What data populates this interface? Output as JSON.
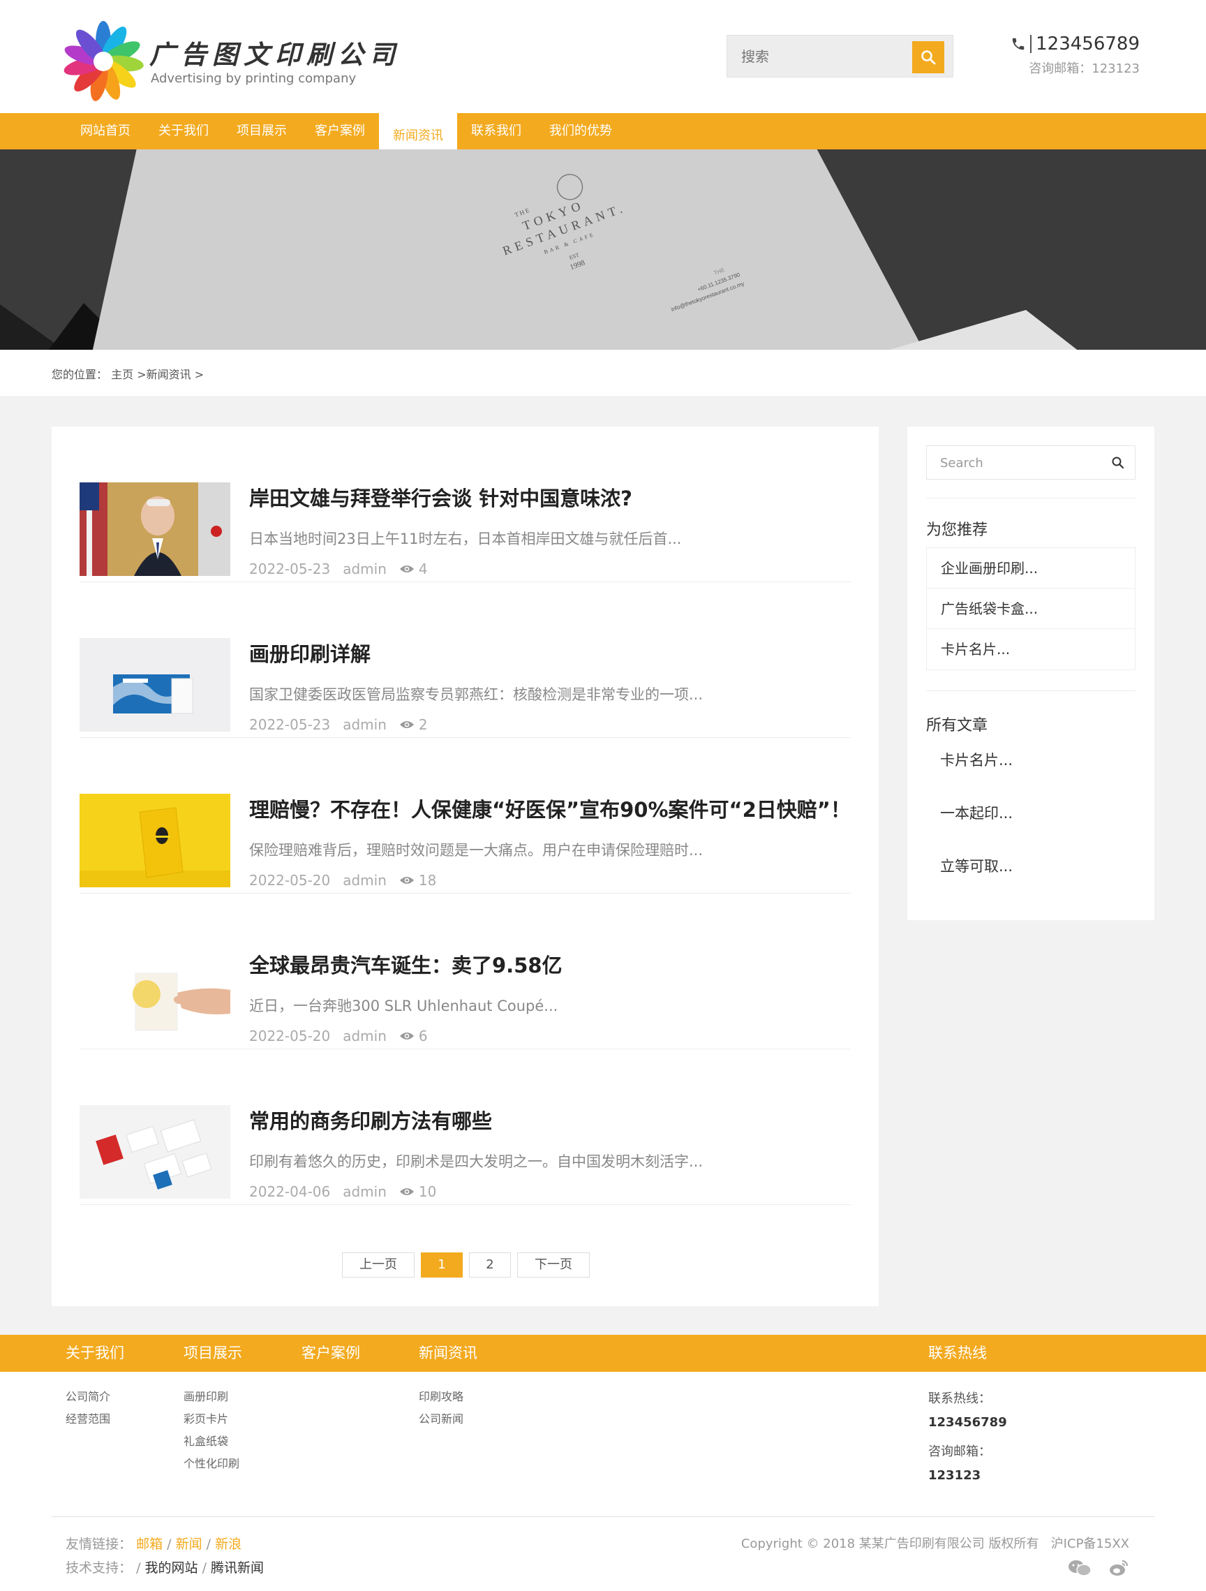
{
  "header": {
    "logo_cn": "广告图文印刷公司",
    "logo_en": "Advertising by printing company",
    "search_placeholder": "搜索",
    "phone": "123456789",
    "email": "咨询邮箱：123123"
  },
  "nav": {
    "items": [
      "网站首页",
      "关于我们",
      "项目展示",
      "客户案例",
      "新闻资讯",
      "联系我们",
      "我们的优势"
    ],
    "active": "新闻资讯"
  },
  "banner": {
    "line1": "THE",
    "line2": "TOKYO",
    "line3": "RESTAURANT.",
    "line4": "BAR & CAFE",
    "line5": "EST",
    "line6": "1998",
    "phone": "+60.11.1235.3790",
    "email": "info@thetokyorestaurant.co.my",
    "tag": "THE"
  },
  "breadcrumb": {
    "label": "您的位置：",
    "home": "主页",
    "current": "新闻资讯",
    "sep": ">"
  },
  "articles": [
    {
      "title": "岸田文雄与拜登举行会谈 针对中国意味浓?",
      "desc": "日本当地时间23日上午11时左右，日本首相岸田文雄与就任后首...",
      "date": "2022-05-23",
      "author": "admin",
      "views": "4"
    },
    {
      "title": "画册印刷详解",
      "desc": "国家卫健委医政医管局监察专员郭燕红：核酸检测是非常专业的一项...",
      "date": "2022-05-23",
      "author": "admin",
      "views": "2"
    },
    {
      "title": "理赔慢？不存在！人保健康“好医保”宣布90%案件可“2日快赔”！",
      "desc": "保险理赔难背后，理赔时效问题是一大痛点。用户在申请保险理赔时...",
      "date": "2022-05-20",
      "author": "admin",
      "views": "18"
    },
    {
      "title": "全球最昂贵汽车诞生：卖了9.58亿",
      "desc": "近日，一台奔驰300 SLR Uhlenhaut Coupé...",
      "date": "2022-05-20",
      "author": "admin",
      "views": "6"
    },
    {
      "title": "常用的商务印刷方法有哪些",
      "desc": "印刷有着悠久的历史，印刷术是四大发明之一。自中国发明木刻活字...",
      "date": "2022-04-06",
      "author": "admin",
      "views": "10"
    }
  ],
  "pager": {
    "prev": "上一页",
    "pages": [
      "1",
      "2"
    ],
    "current": "1",
    "next": "下一页"
  },
  "sidebar": {
    "search_placeholder": "Search",
    "recommend_title": "为您推荐",
    "recommend": [
      "企业画册印刷...",
      "广告纸袋卡盒...",
      "卡片名片..."
    ],
    "all_title": "所有文章",
    "all": [
      "卡片名片...",
      "一本起印...",
      "立等可取..."
    ]
  },
  "footer": {
    "heads": [
      "关于我们",
      "项目展示",
      "客户案例",
      "新闻资讯",
      "联系热线"
    ],
    "col1": [
      "公司简介",
      "经营范围"
    ],
    "col2": [
      "画册印刷",
      "彩页卡片",
      "礼盒纸袋",
      "个性化印刷"
    ],
    "col4": [
      "印刷攻略",
      "公司新闻"
    ],
    "contact": {
      "hotline_label": "联系热线：",
      "hotline": "123456789",
      "email_label": "咨询邮箱：",
      "email": "123123"
    },
    "links_label": "友情链接：",
    "links": [
      "邮箱",
      "新闻",
      "新浪"
    ],
    "support_label": "技术支持：",
    "support": [
      "我的网站",
      "腾讯新闻"
    ],
    "copyright": "Copyright © 2018 某某广告印刷有限公司 版权所有",
    "icp": "沪ICP备15XX"
  },
  "colors": {
    "accent": "#f3aa1f",
    "footer_bar": "#f3aa1f",
    "banner_bg": "#3b3b3b"
  }
}
